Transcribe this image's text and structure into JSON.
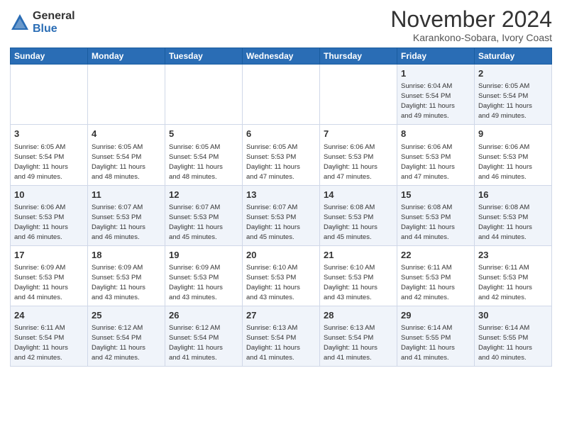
{
  "logo": {
    "general": "General",
    "blue": "Blue"
  },
  "title": "November 2024",
  "location": "Karankono-Sobara, Ivory Coast",
  "days_of_week": [
    "Sunday",
    "Monday",
    "Tuesday",
    "Wednesday",
    "Thursday",
    "Friday",
    "Saturday"
  ],
  "weeks": [
    [
      {
        "day": "",
        "info": ""
      },
      {
        "day": "",
        "info": ""
      },
      {
        "day": "",
        "info": ""
      },
      {
        "day": "",
        "info": ""
      },
      {
        "day": "",
        "info": ""
      },
      {
        "day": "1",
        "info": "Sunrise: 6:04 AM\nSunset: 5:54 PM\nDaylight: 11 hours\nand 49 minutes."
      },
      {
        "day": "2",
        "info": "Sunrise: 6:05 AM\nSunset: 5:54 PM\nDaylight: 11 hours\nand 49 minutes."
      }
    ],
    [
      {
        "day": "3",
        "info": "Sunrise: 6:05 AM\nSunset: 5:54 PM\nDaylight: 11 hours\nand 49 minutes."
      },
      {
        "day": "4",
        "info": "Sunrise: 6:05 AM\nSunset: 5:54 PM\nDaylight: 11 hours\nand 48 minutes."
      },
      {
        "day": "5",
        "info": "Sunrise: 6:05 AM\nSunset: 5:54 PM\nDaylight: 11 hours\nand 48 minutes."
      },
      {
        "day": "6",
        "info": "Sunrise: 6:05 AM\nSunset: 5:53 PM\nDaylight: 11 hours\nand 47 minutes."
      },
      {
        "day": "7",
        "info": "Sunrise: 6:06 AM\nSunset: 5:53 PM\nDaylight: 11 hours\nand 47 minutes."
      },
      {
        "day": "8",
        "info": "Sunrise: 6:06 AM\nSunset: 5:53 PM\nDaylight: 11 hours\nand 47 minutes."
      },
      {
        "day": "9",
        "info": "Sunrise: 6:06 AM\nSunset: 5:53 PM\nDaylight: 11 hours\nand 46 minutes."
      }
    ],
    [
      {
        "day": "10",
        "info": "Sunrise: 6:06 AM\nSunset: 5:53 PM\nDaylight: 11 hours\nand 46 minutes."
      },
      {
        "day": "11",
        "info": "Sunrise: 6:07 AM\nSunset: 5:53 PM\nDaylight: 11 hours\nand 46 minutes."
      },
      {
        "day": "12",
        "info": "Sunrise: 6:07 AM\nSunset: 5:53 PM\nDaylight: 11 hours\nand 45 minutes."
      },
      {
        "day": "13",
        "info": "Sunrise: 6:07 AM\nSunset: 5:53 PM\nDaylight: 11 hours\nand 45 minutes."
      },
      {
        "day": "14",
        "info": "Sunrise: 6:08 AM\nSunset: 5:53 PM\nDaylight: 11 hours\nand 45 minutes."
      },
      {
        "day": "15",
        "info": "Sunrise: 6:08 AM\nSunset: 5:53 PM\nDaylight: 11 hours\nand 44 minutes."
      },
      {
        "day": "16",
        "info": "Sunrise: 6:08 AM\nSunset: 5:53 PM\nDaylight: 11 hours\nand 44 minutes."
      }
    ],
    [
      {
        "day": "17",
        "info": "Sunrise: 6:09 AM\nSunset: 5:53 PM\nDaylight: 11 hours\nand 44 minutes."
      },
      {
        "day": "18",
        "info": "Sunrise: 6:09 AM\nSunset: 5:53 PM\nDaylight: 11 hours\nand 43 minutes."
      },
      {
        "day": "19",
        "info": "Sunrise: 6:09 AM\nSunset: 5:53 PM\nDaylight: 11 hours\nand 43 minutes."
      },
      {
        "day": "20",
        "info": "Sunrise: 6:10 AM\nSunset: 5:53 PM\nDaylight: 11 hours\nand 43 minutes."
      },
      {
        "day": "21",
        "info": "Sunrise: 6:10 AM\nSunset: 5:53 PM\nDaylight: 11 hours\nand 43 minutes."
      },
      {
        "day": "22",
        "info": "Sunrise: 6:11 AM\nSunset: 5:53 PM\nDaylight: 11 hours\nand 42 minutes."
      },
      {
        "day": "23",
        "info": "Sunrise: 6:11 AM\nSunset: 5:53 PM\nDaylight: 11 hours\nand 42 minutes."
      }
    ],
    [
      {
        "day": "24",
        "info": "Sunrise: 6:11 AM\nSunset: 5:54 PM\nDaylight: 11 hours\nand 42 minutes."
      },
      {
        "day": "25",
        "info": "Sunrise: 6:12 AM\nSunset: 5:54 PM\nDaylight: 11 hours\nand 42 minutes."
      },
      {
        "day": "26",
        "info": "Sunrise: 6:12 AM\nSunset: 5:54 PM\nDaylight: 11 hours\nand 41 minutes."
      },
      {
        "day": "27",
        "info": "Sunrise: 6:13 AM\nSunset: 5:54 PM\nDaylight: 11 hours\nand 41 minutes."
      },
      {
        "day": "28",
        "info": "Sunrise: 6:13 AM\nSunset: 5:54 PM\nDaylight: 11 hours\nand 41 minutes."
      },
      {
        "day": "29",
        "info": "Sunrise: 6:14 AM\nSunset: 5:55 PM\nDaylight: 11 hours\nand 41 minutes."
      },
      {
        "day": "30",
        "info": "Sunrise: 6:14 AM\nSunset: 5:55 PM\nDaylight: 11 hours\nand 40 minutes."
      }
    ]
  ]
}
